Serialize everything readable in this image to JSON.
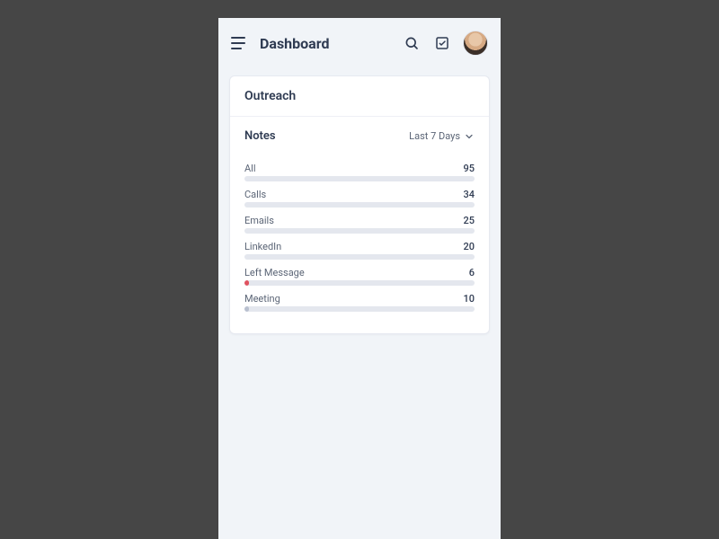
{
  "header": {
    "title": "Dashboard"
  },
  "card": {
    "title": "Outreach",
    "section_label": "Notes",
    "range_label": "Last 7 Days"
  },
  "colors": {
    "fill_default": "#b9c0cf",
    "fill_accent": "#e0525f"
  },
  "chart_data": {
    "type": "bar",
    "orientation": "horizontal",
    "title": "Notes",
    "xlabel": "",
    "ylabel": "",
    "series": [
      {
        "name": "All",
        "value": 95,
        "fill_pct": 0,
        "color": "fill_default"
      },
      {
        "name": "Calls",
        "value": 34,
        "fill_pct": 0,
        "color": "fill_default"
      },
      {
        "name": "Emails",
        "value": 25,
        "fill_pct": 0,
        "color": "fill_default"
      },
      {
        "name": "LinkedIn",
        "value": 20,
        "fill_pct": 0,
        "color": "fill_default"
      },
      {
        "name": "Left Message",
        "value": 6,
        "fill_pct": 2,
        "color": "fill_accent"
      },
      {
        "name": "Meeting",
        "value": 10,
        "fill_pct": 2,
        "color": "fill_default"
      }
    ]
  }
}
